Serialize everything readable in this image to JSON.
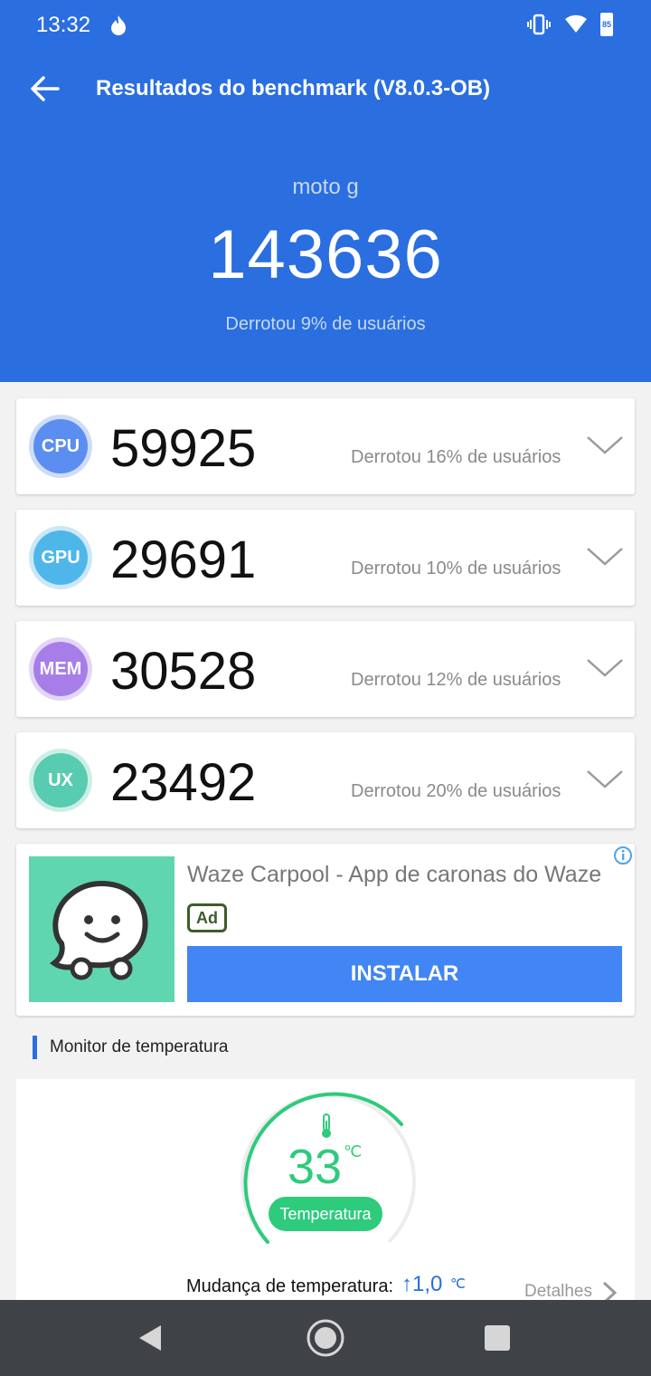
{
  "status_bar": {
    "time": "13:32",
    "battery_level": "85"
  },
  "app_bar": {
    "title": "Resultados do benchmark (V8.0.3-OB)"
  },
  "summary": {
    "device": "moto g",
    "total_score": "143636",
    "beat_text": "Derrotou 9% de usuários"
  },
  "scores": [
    {
      "label": "CPU",
      "score": "59925",
      "beat": "Derrotou 16% de usuários",
      "color": "#5b8ef0",
      "ring": "#cfdcf8"
    },
    {
      "label": "GPU",
      "score": "29691",
      "beat": "Derrotou 10% de usuários",
      "color": "#4fb6ea",
      "ring": "#cbe8f7"
    },
    {
      "label": "MEM",
      "score": "30528",
      "beat": "Derrotou 12% de usuários",
      "color": "#a77ee8",
      "ring": "#e3d6f7"
    },
    {
      "label": "UX",
      "score": "23492",
      "beat": "Derrotou 20% de usuários",
      "color": "#57ccb0",
      "ring": "#cdeee6"
    }
  ],
  "ad": {
    "title": "Waze Carpool - App de caronas do Waze",
    "tag": "Ad",
    "button": "INSTALAR"
  },
  "temperature": {
    "section_title": "Monitor de temperatura",
    "value": "33",
    "unit": "℃",
    "label": "Temperatura",
    "change_label": "Mudança de temperatura:",
    "change_value": "↑1,0",
    "change_unit": "℃",
    "details": "Detalhes"
  },
  "colors": {
    "primary": "#2a6ee0",
    "temp_green": "#2ecb7c",
    "ad_button": "#4285f4"
  }
}
